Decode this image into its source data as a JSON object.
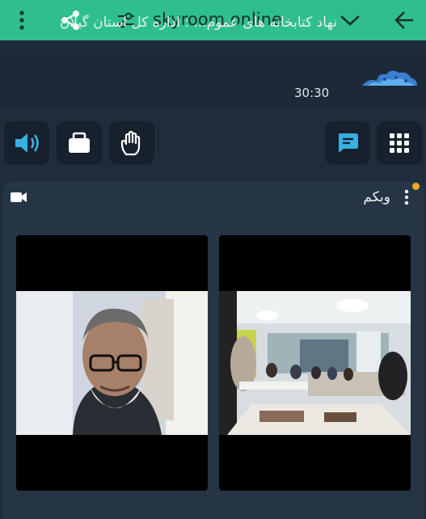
{
  "browser": {
    "url": "skyroom.online",
    "icons": [
      "more-vertical-icon",
      "share-icon",
      "tune-icon",
      "chevron-down-icon",
      "back-arrow-icon"
    ]
  },
  "room": {
    "title": "نهاد کتابخانه های عموم... : اداره کل استان گیلان",
    "timer": "30:30"
  },
  "controls": [
    {
      "name": "speaker-button",
      "icon": "speaker-icon",
      "active": true
    },
    {
      "name": "layers-button",
      "icon": "folder-icon"
    },
    {
      "name": "raise-hand-button",
      "icon": "hand-icon"
    },
    {
      "name": "chat-button",
      "icon": "chat-icon",
      "active": true
    },
    {
      "name": "apps-button",
      "icon": "grid-icon"
    }
  ],
  "webcam_panel": {
    "title": "وبکم",
    "icon": "video-camera-icon",
    "status_color": "#f4a522"
  },
  "colors": {
    "toolbar": "#2fbf8f",
    "background": "#1f2c3b",
    "accent": "#39b0e0"
  }
}
